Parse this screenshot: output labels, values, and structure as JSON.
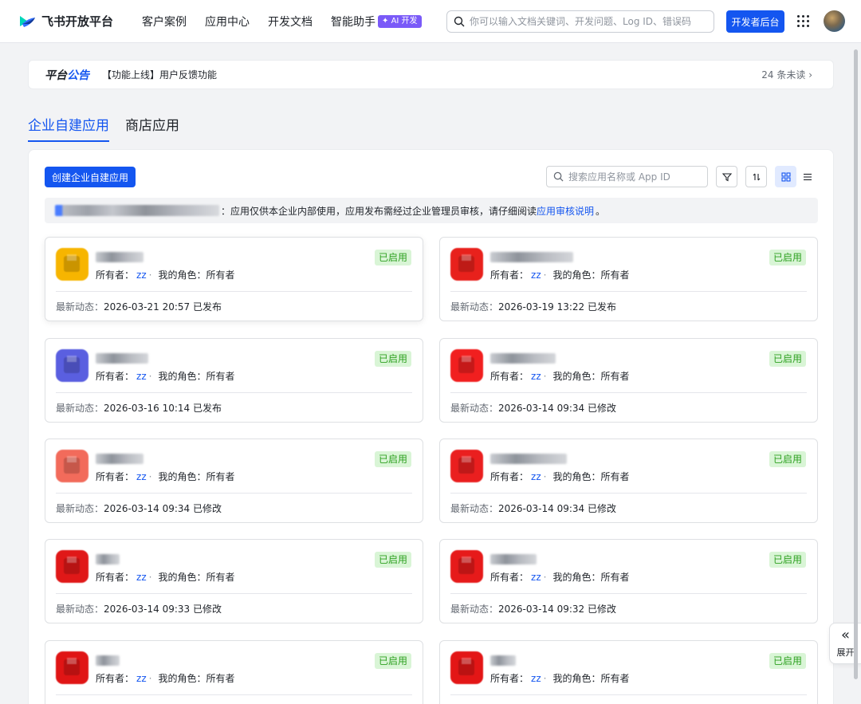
{
  "brand": {
    "name": "飞书开放平台"
  },
  "nav": [
    {
      "label": "客户案例"
    },
    {
      "label": "应用中心"
    },
    {
      "label": "开发文档"
    },
    {
      "label": "智能助手",
      "badge": "AI 开发"
    }
  ],
  "search": {
    "placeholder": "你可以输入文档关键词、开发问题、Log ID、错误码"
  },
  "dev_button": "开发者后台",
  "announcement": {
    "title_a": "平台",
    "title_b": "公告",
    "text": "【功能上线】用户反馈功能",
    "unread": "24 条未读"
  },
  "tabs": [
    {
      "label": "企业自建应用",
      "active": true
    },
    {
      "label": "商店应用",
      "active": false
    }
  ],
  "toolbar": {
    "create_label": "创建企业自建应用",
    "search_placeholder": "搜索应用名称或 App ID"
  },
  "notice": {
    "text": "：应用仅供本企业内部使用，应用发布需经过企业管理员审核，请仔细阅读 ",
    "link": "应用审核说明",
    "tail": "。"
  },
  "card_labels": {
    "owner": "所有者：",
    "role": "我的角色：",
    "activity": "最新动态："
  },
  "apps": [
    {
      "owner": "zz",
      "role": "所有者",
      "status": "已启用",
      "time": "2026-03-21 20:57",
      "action": "已发布",
      "icon_color": "#f7b500"
    },
    {
      "owner": "zz",
      "role": "所有者",
      "status": "已启用",
      "time": "2026-03-19 13:22",
      "action": "已发布",
      "icon_color": "#e8211c"
    },
    {
      "owner": "zz",
      "role": "所有者",
      "status": "已启用",
      "time": "2026-03-16 10:14",
      "action": "已发布",
      "icon_color": "#5a5fe0"
    },
    {
      "owner": "zz",
      "role": "所有者",
      "status": "已启用",
      "time": "2026-03-14 09:34",
      "action": "已修改",
      "icon_color": "#f11f1f"
    },
    {
      "owner": "zz",
      "role": "所有者",
      "status": "已启用",
      "time": "2026-03-14 09:34",
      "action": "已修改",
      "icon_color": "#f26b5b"
    },
    {
      "owner": "zz",
      "role": "所有者",
      "status": "已启用",
      "time": "2026-03-14 09:34",
      "action": "已修改",
      "icon_color": "#ea1f1f"
    },
    {
      "owner": "zz",
      "role": "所有者",
      "status": "已启用",
      "time": "2026-03-14 09:33",
      "action": "已修改",
      "icon_color": "#e01818"
    },
    {
      "owner": "zz",
      "role": "所有者",
      "status": "已启用",
      "time": "2026-03-14 09:32",
      "action": "已修改",
      "icon_color": "#e61a1a"
    },
    {
      "owner": "zz",
      "role": "所有者",
      "status": "已启用",
      "time": "",
      "action": "",
      "icon_color": "#e01515"
    },
    {
      "owner": "zz",
      "role": "所有者",
      "status": "已启用",
      "time": "",
      "action": "",
      "icon_color": "#e31616"
    }
  ],
  "expand": {
    "label": "展开"
  },
  "colors": {
    "accent": "#1456f0",
    "success_bg": "#d9f5d6",
    "success_text": "#2ea121",
    "ai_badge": "#7a5af8"
  }
}
